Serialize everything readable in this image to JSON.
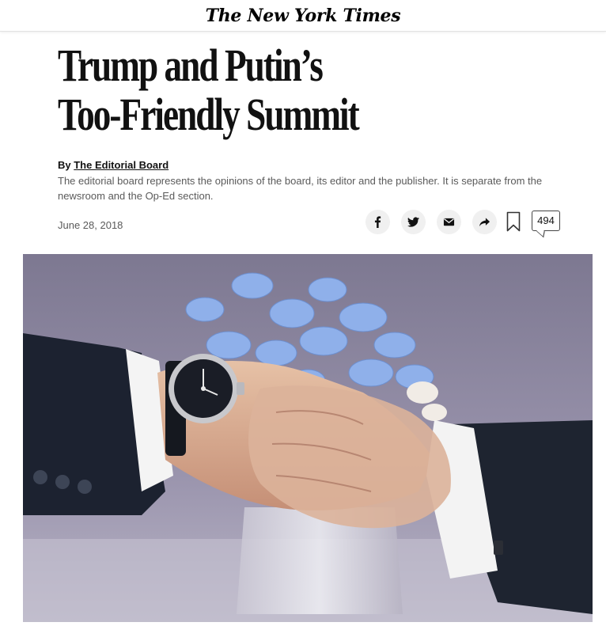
{
  "masthead": {
    "logo_text": "The New York Times"
  },
  "article": {
    "headline_line1": "Trump and Putin’s",
    "headline_line2": "Too-Friendly Summit",
    "byline_prefix": "By ",
    "byline_author": "The Editorial Board",
    "disclaimer": "The editorial board represents the opinions of the board, its editor and the publisher. It is separate from the newsroom and the Op-Ed section.",
    "date": "June 28, 2018"
  },
  "share": {
    "icons": [
      "facebook-icon",
      "twitter-icon",
      "email-icon",
      "share-arrow-icon",
      "bookmark-icon"
    ],
    "comment_count": "494"
  },
  "image": {
    "subject": "handshake",
    "colors": {
      "background": "#8d87a0",
      "flowers": "#8fb0ea",
      "suit": "#1e2430",
      "cuff": "#f4f4f4"
    }
  }
}
